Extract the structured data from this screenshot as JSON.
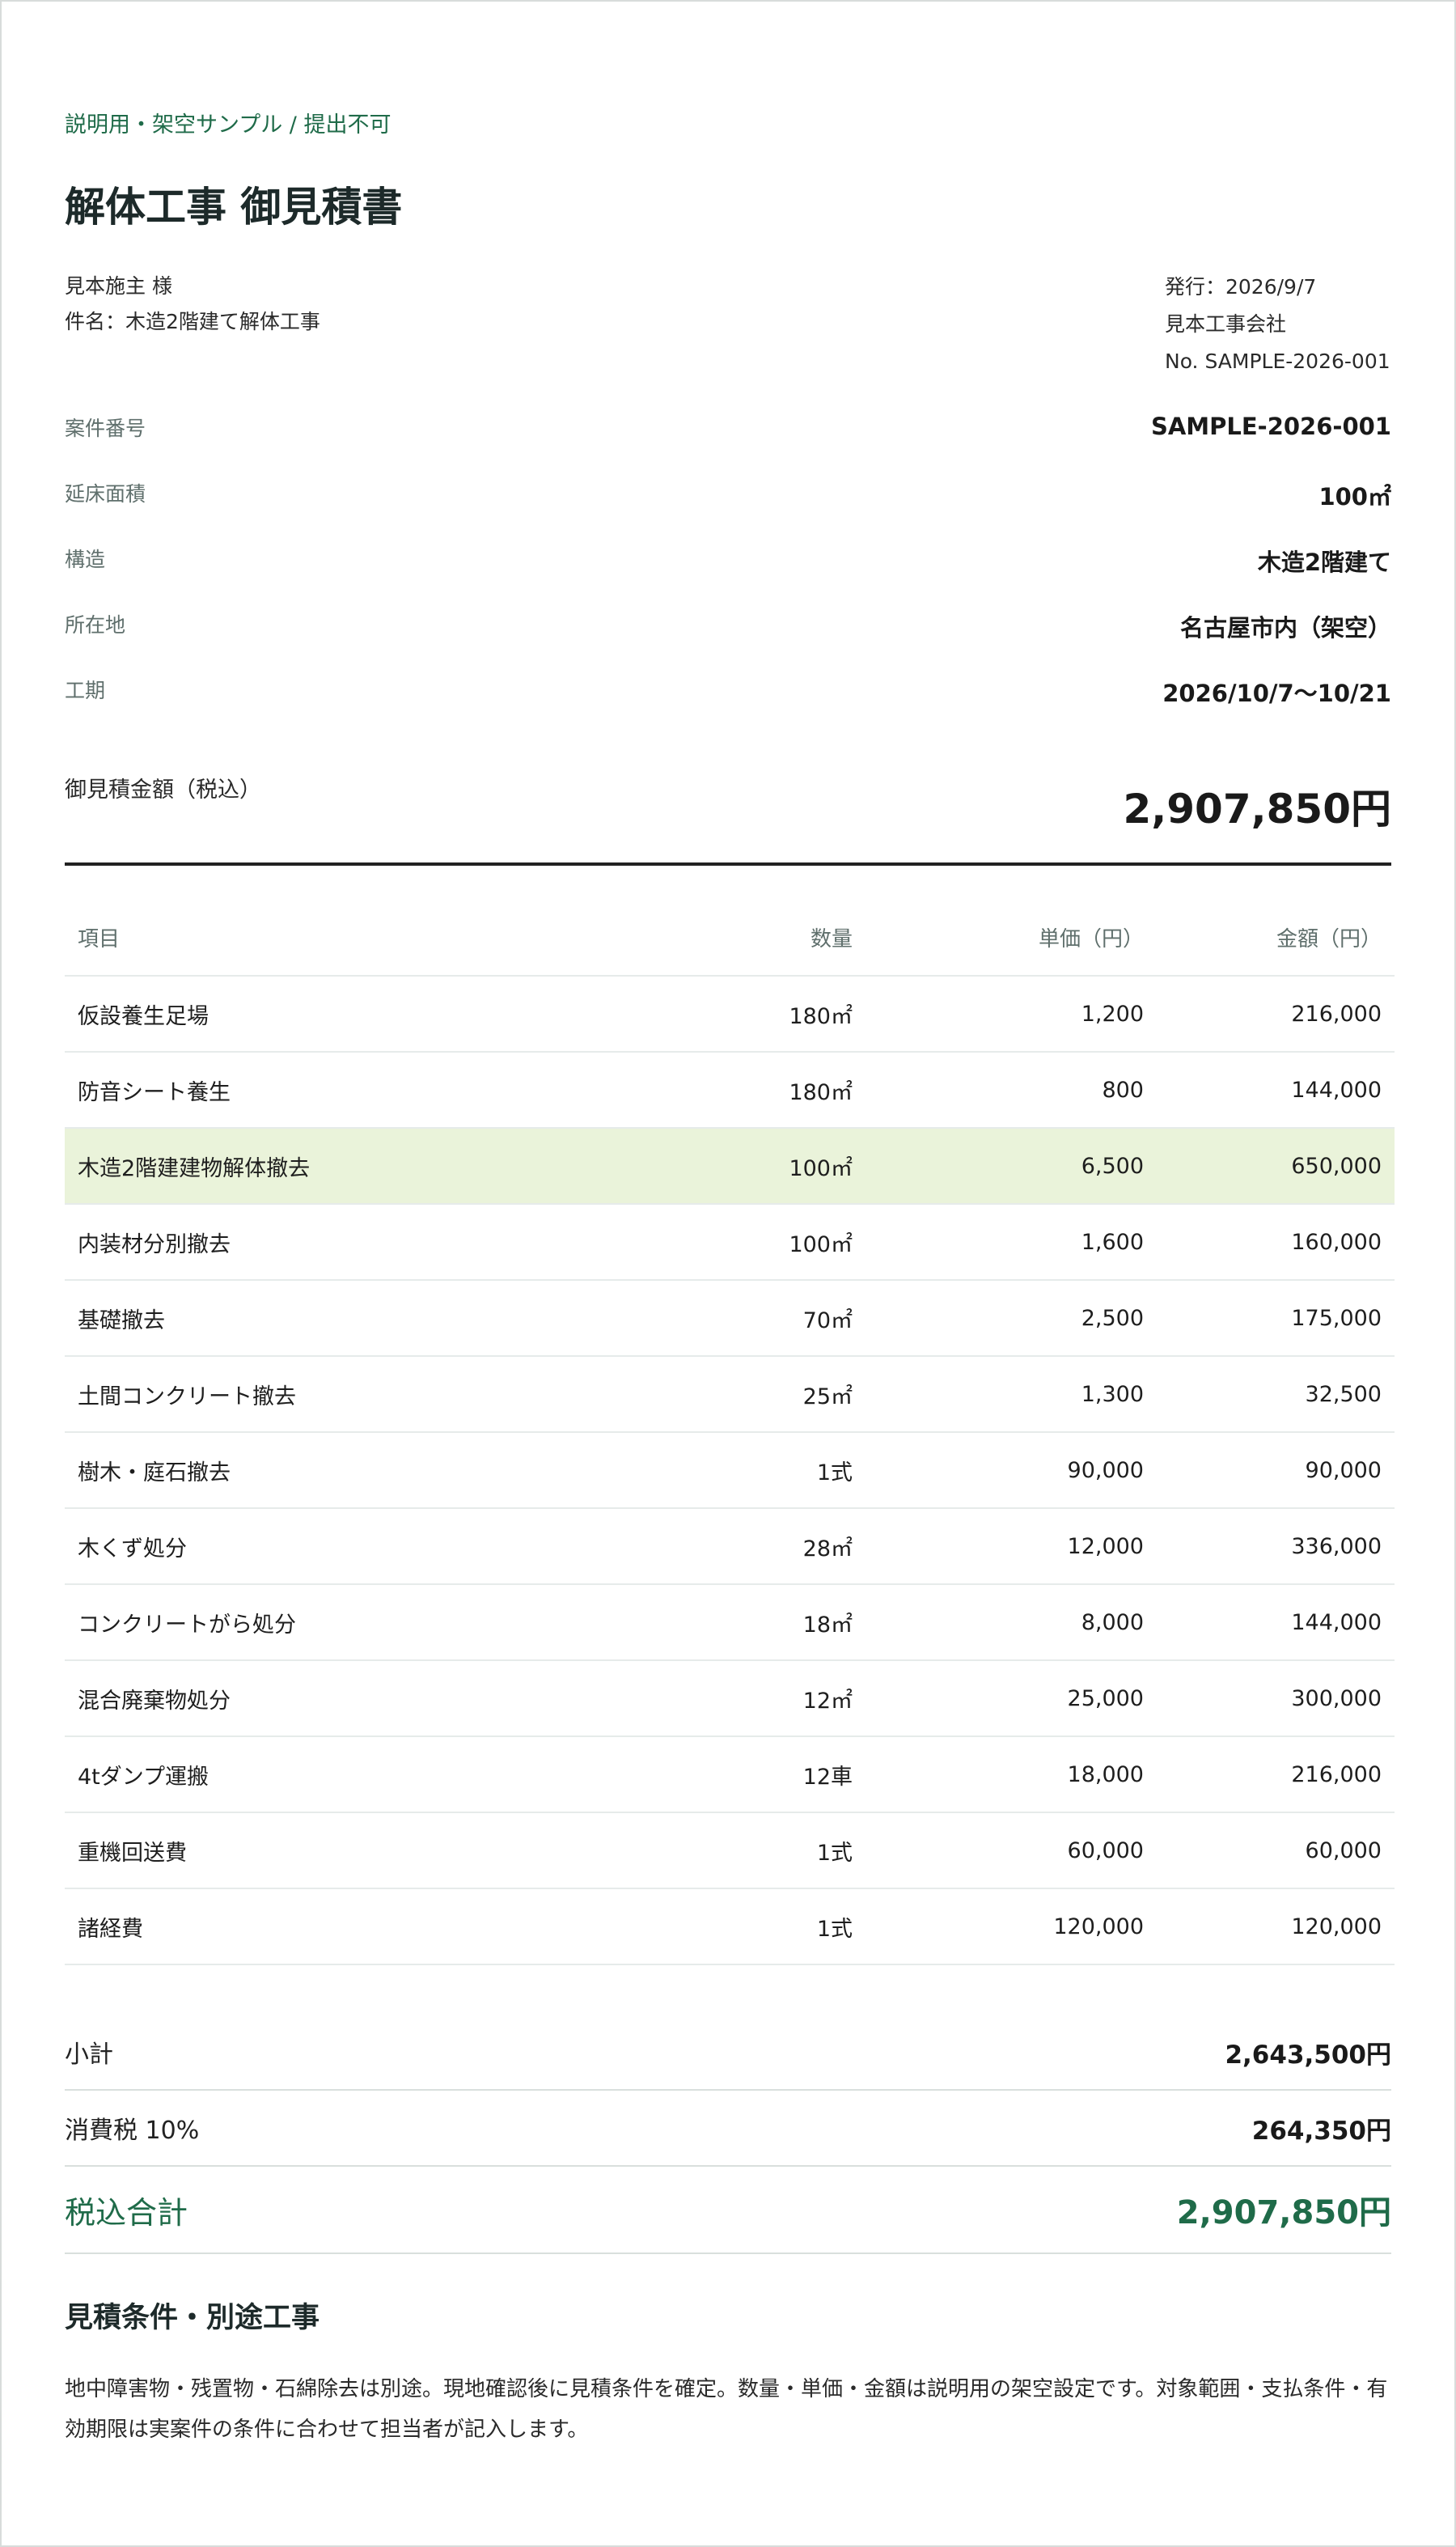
{
  "notice": "説明用・架空サンプル / 提出不可",
  "title": "解体工事 御見積書",
  "client": {
    "name": "見本施主 様",
    "subject": "件名：木造2階建て解体工事"
  },
  "issuer": {
    "issue_date": "発行：2026/9/7",
    "company": "見本工事会社",
    "number": "No. SAMPLE-2026-001"
  },
  "info": [
    {
      "label": "案件番号",
      "value": "SAMPLE-2026-001"
    },
    {
      "label": "延床面積",
      "value": "100㎡"
    },
    {
      "label": "構造",
      "value": "木造2階建て"
    },
    {
      "label": "所在地",
      "value": "名古屋市内（架空）"
    },
    {
      "label": "工期",
      "value": "2026/10/7〜10/21"
    }
  ],
  "estimate_total": {
    "label": "御見積金額（税込）",
    "value": "2,907,850円"
  },
  "table": {
    "headers": [
      "項目",
      "数量",
      "単価（円）",
      "金額（円）"
    ],
    "rows": [
      {
        "item": "仮設養生足場",
        "qty": "180㎡",
        "unit_price": "1,200",
        "amount": "216,000"
      },
      {
        "item": "防音シート養生",
        "qty": "180㎡",
        "unit_price": "800",
        "amount": "144,000"
      },
      {
        "item": "木造2階建建物解体撤去",
        "qty": "100㎡",
        "unit_price": "6,500",
        "amount": "650,000"
      },
      {
        "item": "内装材分別撤去",
        "qty": "100㎡",
        "unit_price": "1,600",
        "amount": "160,000"
      },
      {
        "item": "基礎撤去",
        "qty": "70㎡",
        "unit_price": "2,500",
        "amount": "175,000"
      },
      {
        "item": "土間コンクリート撤去",
        "qty": "25㎡",
        "unit_price": "1,300",
        "amount": "32,500"
      },
      {
        "item": "樹木・庭石撤去",
        "qty": "1式",
        "unit_price": "90,000",
        "amount": "90,000"
      },
      {
        "item": "木くず処分",
        "qty": "28㎡",
        "unit_price": "12,000",
        "amount": "336,000"
      },
      {
        "item": "コンクリートがら処分",
        "qty": "18㎡",
        "unit_price": "8,000",
        "amount": "144,000"
      },
      {
        "item": "混合廃棄物処分",
        "qty": "12㎡",
        "unit_price": "25,000",
        "amount": "300,000"
      },
      {
        "item": "4tダンプ運搬",
        "qty": "12車",
        "unit_price": "18,000",
        "amount": "216,000"
      },
      {
        "item": "重機回送費",
        "qty": "1式",
        "unit_price": "60,000",
        "amount": "60,000"
      },
      {
        "item": "諸経費",
        "qty": "1式",
        "unit_price": "120,000",
        "amount": "120,000"
      }
    ]
  },
  "summary": {
    "subtotal_label": "小計",
    "subtotal_value": "2,643,500円",
    "tax_label": "消費税 10%",
    "tax_value": "264,350円",
    "grand_label": "税込合計",
    "grand_value": "2,907,850円"
  },
  "conditions": {
    "title": "見積条件・別途工事",
    "body": "地中障害物・残置物・石綿除去は別途。現地確認後に見積条件を確定。数量・単価・金額は説明用の架空設定です。対象範囲・支払条件・有効期限は実案件の条件に合わせて担当者が記入します。"
  },
  "colors": {
    "accent_green": "#1f6b49",
    "highlight_row": "#eaf3da"
  }
}
